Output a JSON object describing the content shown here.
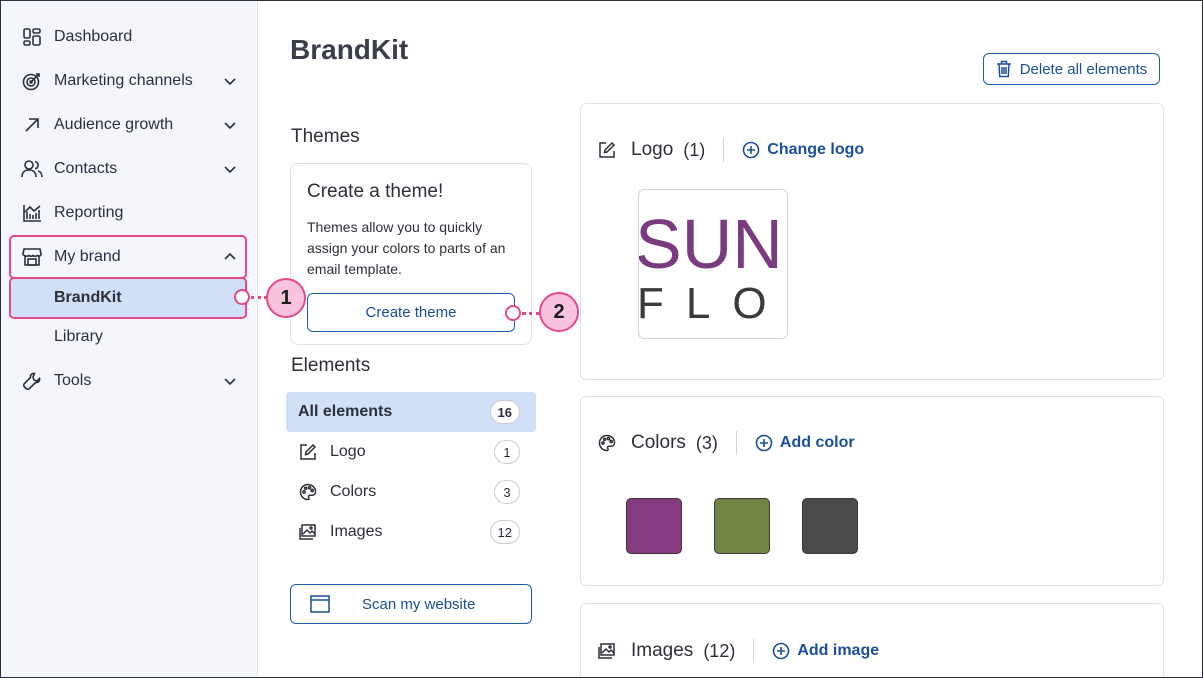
{
  "sidebar": {
    "items": [
      {
        "label": "Dashboard",
        "icon": "dashboard-icon"
      },
      {
        "label": "Marketing channels",
        "icon": "target-icon"
      },
      {
        "label": "Audience growth",
        "icon": "growth-arrow-icon"
      },
      {
        "label": "Contacts",
        "icon": "contacts-icon"
      },
      {
        "label": "Reporting",
        "icon": "chart-icon"
      },
      {
        "label": "My brand",
        "icon": "storefront-icon"
      },
      {
        "label": "Tools",
        "icon": "wrench-icon"
      }
    ],
    "sub_items": [
      {
        "label": "BrandKit"
      },
      {
        "label": "Library"
      }
    ]
  },
  "page": {
    "title": "BrandKit",
    "delete_all_label": "Delete all elements"
  },
  "themes": {
    "heading": "Themes",
    "card_title": "Create a theme!",
    "card_text": "Themes allow you to quickly assign your colors to parts of an email template.",
    "create_button": "Create theme"
  },
  "elements": {
    "heading": "Elements",
    "rows": [
      {
        "label": "All elements",
        "count": "16"
      },
      {
        "label": "Logo",
        "count": "1"
      },
      {
        "label": "Colors",
        "count": "3"
      },
      {
        "label": "Images",
        "count": "12"
      }
    ],
    "scan_button": "Scan my website"
  },
  "panels": {
    "logo": {
      "title": "Logo",
      "count": "(1)",
      "action": "Change logo"
    },
    "colors": {
      "title": "Colors",
      "count": "(3)",
      "action": "Add color",
      "swatches": [
        "#853b7f",
        "#718443",
        "#4a4a4a"
      ]
    },
    "images": {
      "title": "Images",
      "count": "(12)",
      "action": "Add image"
    }
  },
  "logo_text": {
    "line1": "SUN",
    "line2": "FLOR"
  },
  "callouts": [
    {
      "number": "1"
    },
    {
      "number": "2"
    }
  ],
  "colors": {
    "accent": "#1b4f99",
    "highlight": "#e6488c",
    "active_bg": "#cfe0f7"
  }
}
